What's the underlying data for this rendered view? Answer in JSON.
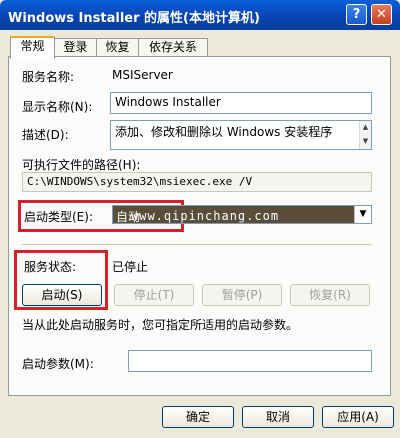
{
  "window": {
    "title": "Windows Installer 的属性(本地计算机)",
    "help_glyph": "?",
    "close_glyph": "✕"
  },
  "tabs": [
    {
      "label": "常规",
      "active": true
    },
    {
      "label": "登录"
    },
    {
      "label": "恢复"
    },
    {
      "label": "依存关系"
    }
  ],
  "general": {
    "service_name_label": "服务名称:",
    "service_name_value": "MSIServer",
    "display_name_label": "显示名称(N):",
    "display_name_value": "Windows Installer",
    "description_label": "描述(D):",
    "description_value": "添加、修改和删除以 Windows 安装程序",
    "path_label": "可执行文件的路径(H):",
    "path_value": "C:\\WINDOWS\\system32\\msiexec.exe /V",
    "startup_type_label": "启动类型(E):",
    "startup_type_value": "自动",
    "watermark": "www.qipinchang.com",
    "service_status_label": "服务状态:",
    "service_status_value": "已停止",
    "start_button": "启动(S)",
    "stop_button": "停止(T)",
    "pause_button": "暂停(P)",
    "resume_button": "恢复(R)",
    "hint_text": "当从此处启动服务时，您可指定所适用的启动参数。",
    "start_params_label": "启动参数(M):",
    "start_params_value": ""
  },
  "footer": {
    "ok_button": "确定",
    "cancel_button": "取消",
    "apply_button": "应用(A)"
  },
  "colors": {
    "highlight_box": "#d8202a",
    "titlebar": "#0842b0"
  }
}
